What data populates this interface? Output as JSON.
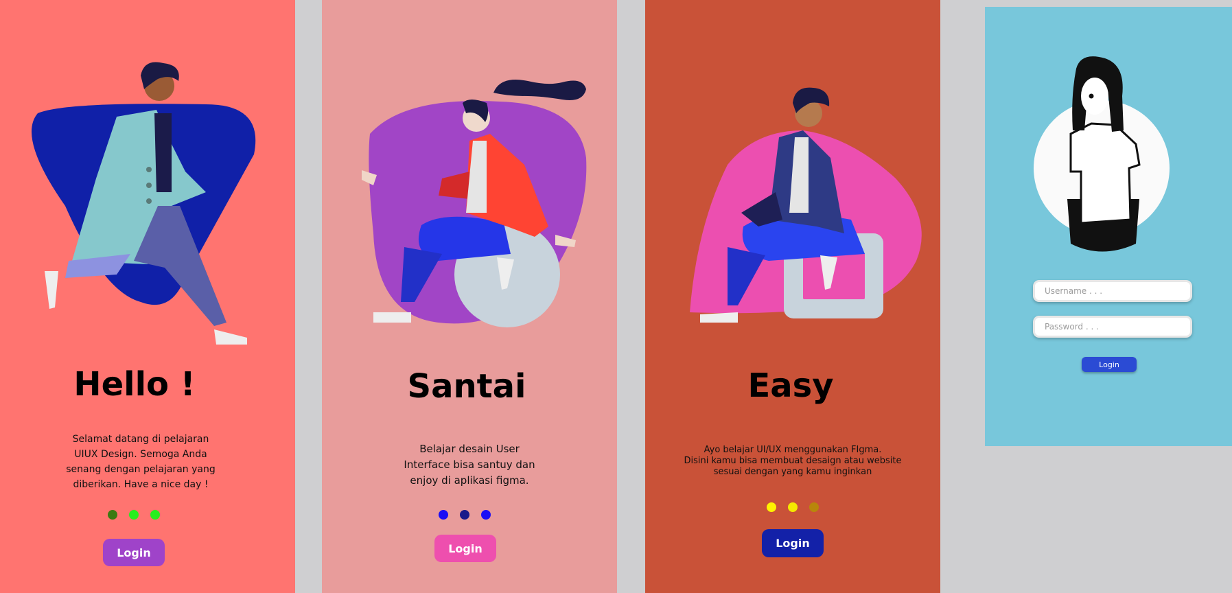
{
  "screens": [
    {
      "title": "Hello !",
      "description": [
        "Selamat datang di pelajaran",
        "UIUX Design. Semoga Anda",
        "senang dengan pelajaran yang",
        "diberikan. Have a nice day !"
      ],
      "button": "Login",
      "dot_colors": [
        "#3b7a12",
        "#27ee1e",
        "#27ee1e"
      ],
      "button_color": "#9f43c9"
    },
    {
      "title": "Santai",
      "description": [
        "Belajar desain User",
        "Interface bisa santuy dan",
        "enjoy di aplikasi figma."
      ],
      "button": "Login",
      "dot_colors": [
        "#1b0df5",
        "#1a1a8a",
        "#1b0df5"
      ],
      "button_color": "#ee4fae"
    },
    {
      "title": "Easy",
      "description": [
        "Ayo belajar UI/UX menggunakan FIgma.",
        "Disini kamu bisa membuat desaign atau website",
        "sesuai dengan yang kamu inginkan"
      ],
      "button": "Login",
      "dot_colors": [
        "#fff200",
        "#f5e800",
        "#b8860b"
      ],
      "button_color": "#1321a8"
    }
  ],
  "login_screen": {
    "username_placeholder": "Username . . .",
    "password_placeholder": "Password . . .",
    "button": "Login"
  }
}
